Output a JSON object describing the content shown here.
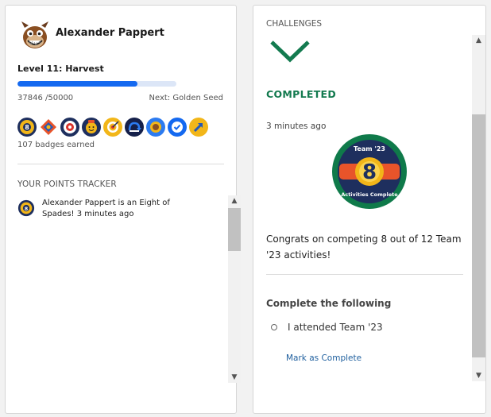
{
  "profile": {
    "name": "Alexander Pappert",
    "level": "Level 11: Harvest",
    "points": "37846 /50000",
    "points_value": 37846,
    "points_max": 50000,
    "next_level": "Next: Golden Seed",
    "badges_earned": "107 badges earned",
    "badge_icons": [
      "eight-of-spades",
      "team-diamond",
      "compass",
      "avatar-badge",
      "target",
      "chart",
      "sunflower",
      "check-circle",
      "arrow-up-right"
    ]
  },
  "tracker": {
    "title": "YOUR POINTS TRACKER",
    "items": [
      {
        "text": "Alexander Pappert is an Eight of Spades! 3 minutes ago"
      }
    ]
  },
  "challenge": {
    "header": "CHALLENGES",
    "status": "COMPLETED",
    "time": "3 minutes ago",
    "badge": {
      "top_text": "Team '23",
      "number": "8",
      "bottom_text": "Activities Complete"
    },
    "description": "Congrats on competing 8 out of 12 Team '23 activities!",
    "complete_following": "Complete the following",
    "tasks": [
      {
        "label": "I attended Team '23"
      }
    ],
    "mark_complete": "Mark as Complete"
  },
  "colors": {
    "accent_blue": "#1469f0",
    "completed_green": "#137a4f",
    "link_blue": "#1f5f9e",
    "badge_ring": "#0f7a4a",
    "badge_navy": "#1e2f5e",
    "badge_yellow": "#f2b619"
  }
}
